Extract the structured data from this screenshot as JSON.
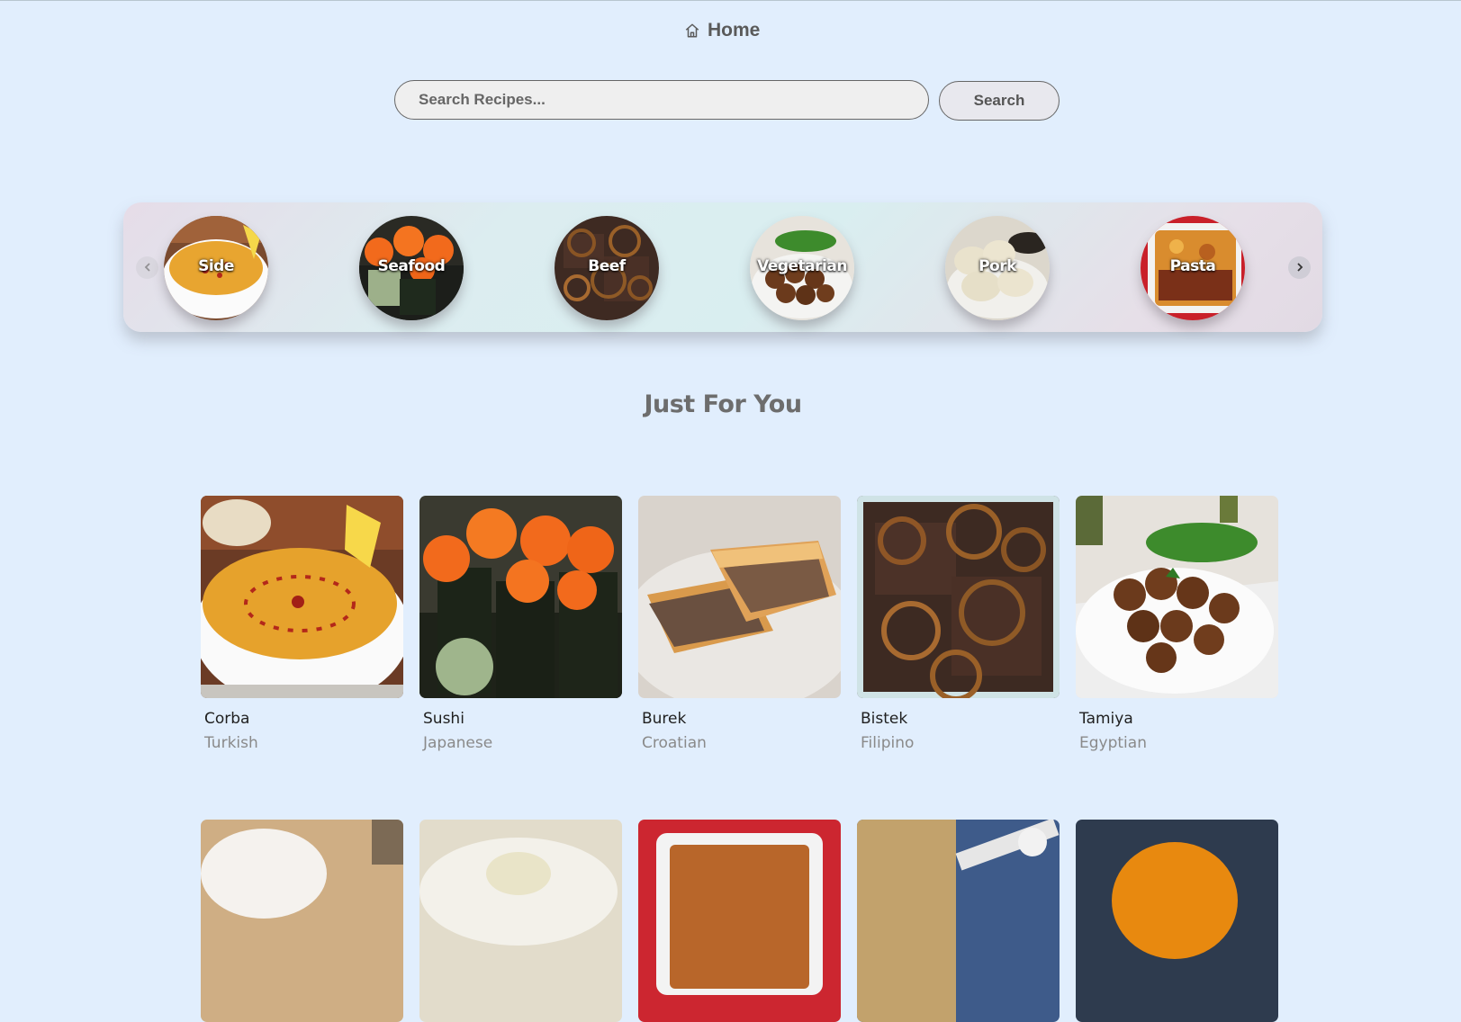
{
  "nav": {
    "home_label": "Home"
  },
  "search": {
    "placeholder": "Search Recipes...",
    "button_label": "Search"
  },
  "categories": [
    {
      "label": "Side"
    },
    {
      "label": "Seafood"
    },
    {
      "label": "Beef"
    },
    {
      "label": "Vegetarian"
    },
    {
      "label": "Pork"
    },
    {
      "label": "Pasta"
    }
  ],
  "section": {
    "title": "Just For You"
  },
  "recipes": [
    {
      "name": "Corba",
      "cuisine": "Turkish"
    },
    {
      "name": "Sushi",
      "cuisine": "Japanese"
    },
    {
      "name": "Burek",
      "cuisine": "Croatian"
    },
    {
      "name": "Bistek",
      "cuisine": "Filipino"
    },
    {
      "name": "Tamiya",
      "cuisine": "Egyptian"
    }
  ]
}
